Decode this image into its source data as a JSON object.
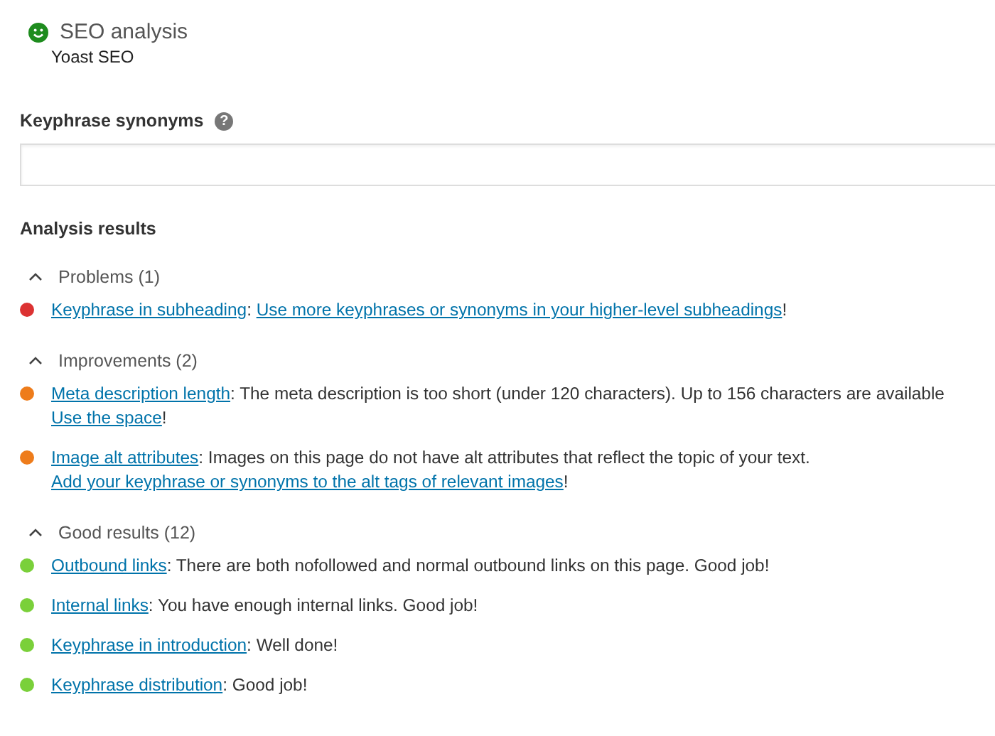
{
  "header": {
    "title": "SEO analysis",
    "subtitle": "Yoast SEO"
  },
  "synonyms": {
    "label": "Keyphrase synonyms",
    "help": "?"
  },
  "analysis": {
    "title": "Analysis results",
    "groups": [
      {
        "label": "Problems (1)",
        "expanded": true,
        "items": [
          {
            "color": "#dc3232",
            "segments": [
              {
                "text": "Keyphrase in subheading",
                "link": true
              },
              {
                "text": ": ",
                "link": false
              },
              {
                "text": "Use more keyphrases or synonyms in your higher-level subheadings",
                "link": true
              },
              {
                "text": "!",
                "link": false
              }
            ]
          }
        ]
      },
      {
        "label": "Improvements (2)",
        "expanded": true,
        "items": [
          {
            "color": "#ee7c1b",
            "segments": [
              {
                "text": "Meta description length",
                "link": true
              },
              {
                "text": ": The meta description is too short (under 120 characters). Up to 156 characters are available ",
                "link": false
              },
              {
                "text": "Use the space",
                "link": true
              },
              {
                "text": "!",
                "link": false
              }
            ]
          },
          {
            "color": "#ee7c1b",
            "segments": [
              {
                "text": "Image alt attributes",
                "link": true
              },
              {
                "text": ": Images on this page do not have alt attributes that reflect the topic of your text. ",
                "link": false
              },
              {
                "text": "Add your keyphrase or synonyms to the alt tags of relevant images",
                "link": true
              },
              {
                "text": "!",
                "link": false
              }
            ]
          }
        ]
      },
      {
        "label": "Good results (12)",
        "expanded": true,
        "items": [
          {
            "color": "#7ad03a",
            "segments": [
              {
                "text": "Outbound links",
                "link": true
              },
              {
                "text": ": There are both nofollowed and normal outbound links on this page. Good job!",
                "link": false
              }
            ]
          },
          {
            "color": "#7ad03a",
            "segments": [
              {
                "text": "Internal links",
                "link": true
              },
              {
                "text": ": You have enough internal links. Good job!",
                "link": false
              }
            ]
          },
          {
            "color": "#7ad03a",
            "segments": [
              {
                "text": "Keyphrase in introduction",
                "link": true
              },
              {
                "text": ": Well done!",
                "link": false
              }
            ]
          },
          {
            "color": "#7ad03a",
            "segments": [
              {
                "text": "Keyphrase distribution",
                "link": true
              },
              {
                "text": ": Good job!",
                "link": false
              }
            ]
          }
        ]
      }
    ]
  }
}
